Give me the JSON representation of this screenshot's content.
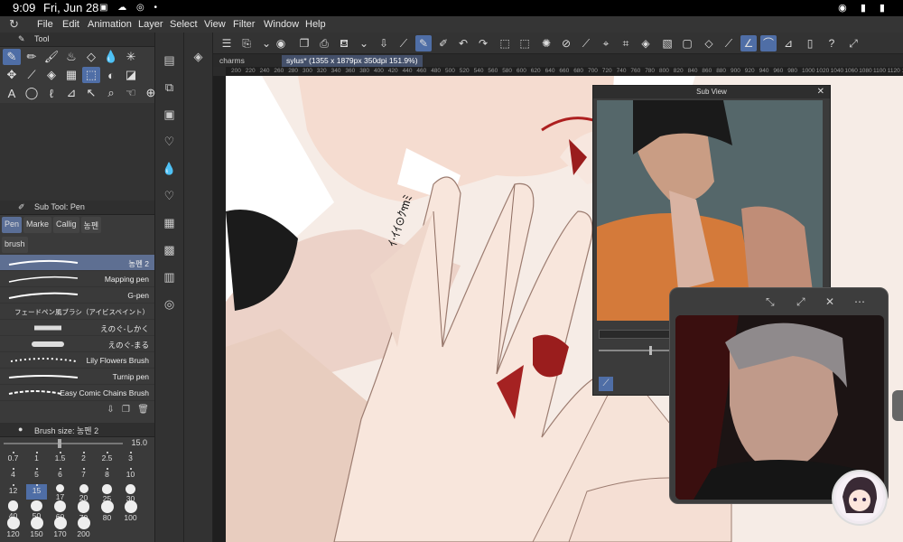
{
  "status": {
    "time": "9:09",
    "date": "Fri, Jun 28",
    "icons": "▣ ☁ ◎ •",
    "right_icons": "◉ ▮ ▮"
  },
  "menu": {
    "items": [
      "File",
      "Edit",
      "Animation",
      "Layer",
      "Select",
      "View",
      "Filter",
      "Window",
      "Help"
    ]
  },
  "tool_panel": {
    "title": "Tool"
  },
  "subtool_panel": {
    "title": "Sub Tool: Pen",
    "tabs": [
      "Pen",
      "Marke",
      "Callig",
      "농펜"
    ],
    "search_label": "brush",
    "brushes": [
      "농펜 2",
      "Mapping pen",
      "G-pen",
      "フェードペン風ブラシ（アイビスペイント）",
      "えのぐ-しかく",
      "えのぐ-まる",
      "Lily Flowers Brush",
      "Turnip pen",
      "Easy Comic Chains Brush"
    ]
  },
  "brush_size": {
    "title": "Brush size: 농펜 2",
    "value": "15.0",
    "sizes": [
      "0.7",
      "1",
      "1.5",
      "2",
      "2.5",
      "3",
      "4",
      "5",
      "6",
      "7",
      "8",
      "10",
      "12",
      "15",
      "17",
      "20",
      "25",
      "30",
      "40",
      "50",
      "60",
      "70",
      "80",
      "100",
      "120",
      "150",
      "170",
      "200"
    ],
    "selected": "15"
  },
  "tabs": {
    "items": [
      "charms",
      "sylus* (1355 x 1879px 350dpi 151.9%)"
    ]
  },
  "ruler": [
    "200",
    "220",
    "240",
    "260",
    "280",
    "300",
    "320",
    "340",
    "360",
    "380",
    "400",
    "420",
    "440",
    "460",
    "480",
    "500",
    "520",
    "540",
    "560",
    "580",
    "600",
    "620",
    "640",
    "660",
    "680",
    "700",
    "720",
    "740",
    "760",
    "780",
    "800",
    "820",
    "840",
    "860",
    "880",
    "900",
    "920",
    "940",
    "960",
    "980",
    "1000",
    "1020",
    "1040",
    "1060",
    "1080",
    "1100",
    "1120",
    "1140"
  ],
  "subview": {
    "title": "Sub View"
  },
  "colors": {
    "accent": "#4f6ea6",
    "panel": "#3a3a3a",
    "canvas_bg": "#f2e6df"
  }
}
